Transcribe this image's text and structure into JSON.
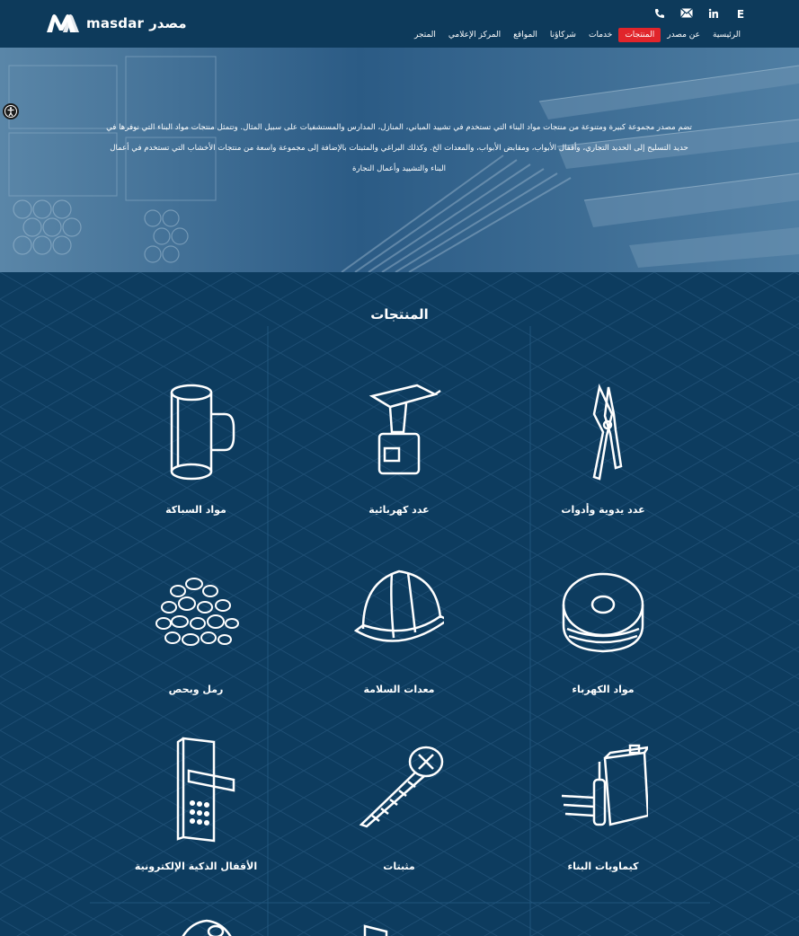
{
  "header": {
    "logo_latin": "masdar",
    "logo_arabic": "مصدر",
    "icons": [
      "phone-icon",
      "mail-icon",
      "linkedin-icon",
      "language-e-icon"
    ],
    "lang_label": "E"
  },
  "nav": {
    "items": [
      {
        "label": "الرئيسية",
        "active": false
      },
      {
        "label": "عن مصدر",
        "active": false
      },
      {
        "label": "المنتجات",
        "active": true
      },
      {
        "label": "خدمات",
        "active": false
      },
      {
        "label": "شركاؤنا",
        "active": false
      },
      {
        "label": "المواقع",
        "active": false
      },
      {
        "label": "المركز الإعلامي",
        "active": false
      },
      {
        "label": "المتجر",
        "active": false
      }
    ]
  },
  "hero": {
    "description": "تضم مصدر مجموعة كبيرة ومتنوعة من منتجات مواد البناء التي تستخدم في تشييد المباني، المنازل، المدارس والمستشفيات على سبيل المثال. وتتمثل منتجات مواد البناء التي نوفرها في حديد التسليح إلى الحديد التجاري، وأقفال الأبواب، ومقابض الأبواب، والمعدات الخ. وكذلك البراغي والمثبتات بالإضافة إلى مجموعة واسعة من منتجات الأخشاب التي تستخدم في أعمال البناء والتشييد وأعمال النجارة"
  },
  "products": {
    "title": "المنتجات",
    "items": [
      {
        "label": "عدد يدوية وأدوات",
        "icon": "pliers-icon"
      },
      {
        "label": "عدد كهربائية",
        "icon": "drill-icon"
      },
      {
        "label": "مواد السباكة",
        "icon": "pipe-fitting-icon"
      },
      {
        "label": "مواد الكهرباء",
        "icon": "wire-spool-icon"
      },
      {
        "label": "معدات السلامة",
        "icon": "hard-hat-icon"
      },
      {
        "label": "رمل وبحص",
        "icon": "gravel-icon"
      },
      {
        "label": "كيماويات البناء",
        "icon": "chemicals-icon"
      },
      {
        "label": "مثبتات",
        "icon": "screw-icon"
      },
      {
        "label": "الأقفال الذكية الإلكترونية",
        "icon": "smart-lock-icon"
      }
    ]
  },
  "colors": {
    "header_bg": "#0d3a5b",
    "active_nav": "#e1252b",
    "section_bg": "#0d3c5f"
  }
}
